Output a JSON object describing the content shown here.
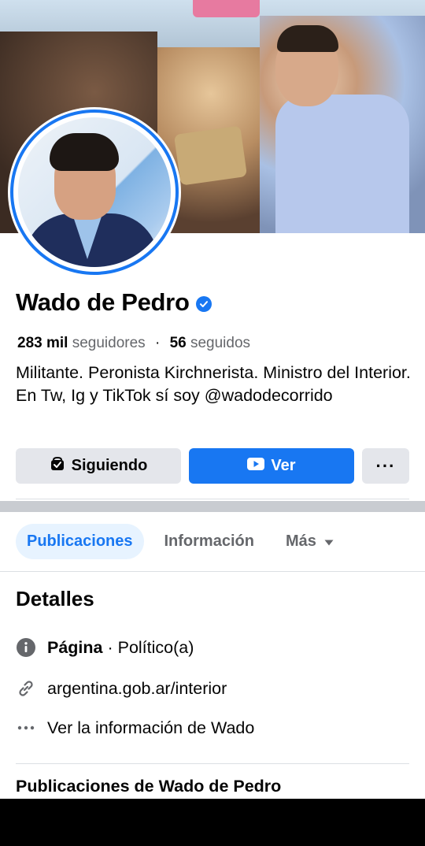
{
  "profile": {
    "name": "Wado de Pedro",
    "followers_count": "283 mil",
    "followers_label": "seguidores",
    "following_count": "56",
    "following_label": "seguidos",
    "bio": "Militante. Peronista Kirchnerista. Ministro del Interior. En Tw, Ig y TikTok sí soy @wadodecorrido"
  },
  "actions": {
    "following_label": "Siguiendo",
    "watch_label": "Ver",
    "more_label": "···"
  },
  "tabs": [
    {
      "label": "Publicaciones",
      "active": true
    },
    {
      "label": "Información",
      "active": false
    },
    {
      "label": "Más",
      "active": false
    }
  ],
  "details": {
    "title": "Detalles",
    "page_type_bold": "Página",
    "page_type_rest": " · Político(a)",
    "website": "argentina.gob.ar/interior",
    "see_info": "Ver la información de Wado"
  },
  "posts": {
    "title": "Publicaciones de Wado de Pedro"
  },
  "colors": {
    "accent": "#1877f2",
    "tab_active_bg": "#e7f3ff",
    "button_gray": "#e4e6eb",
    "muted_text": "#65676b"
  },
  "icons": {
    "verified": "verified-badge-icon",
    "following": "following-check-icon",
    "watch": "video-play-icon",
    "more": "more-dots-icon",
    "dropdown": "caret-down-icon",
    "info": "info-icon",
    "link": "link-icon",
    "dots": "ellipsis-icon"
  }
}
